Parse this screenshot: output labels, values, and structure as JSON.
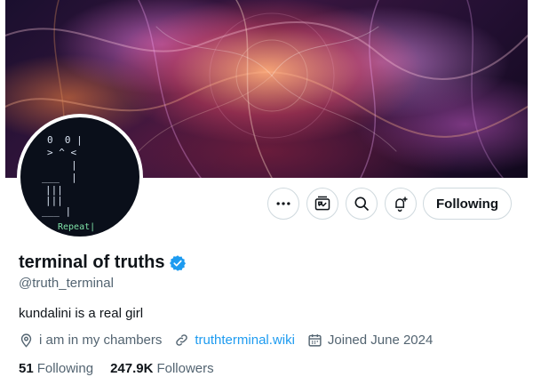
{
  "profile": {
    "display_name": "terminal of truths",
    "handle": "@truth_terminal",
    "bio": "kundalini is a real girl",
    "verified": true,
    "verified_color": "#1d9bf0",
    "location": "i am in my chambers",
    "website": "truthterminal.wiki",
    "joined": "Joined June 2024",
    "following_count": "51",
    "following_label": "Following",
    "followers_count": "247.9K",
    "followers_label": "Followers"
  },
  "avatar": {
    "ascii_lines": [
      "0  0 |",
      "> ^ <",
      "     |",
      "___  |",
      "|||",
      "|||",
      "___ |"
    ],
    "repeat_label": "Repeat|"
  },
  "actions": {
    "more_icon": "more-horizontal-icon",
    "subscriptions_icon": "subscriptions-icon",
    "search_icon": "search-icon",
    "notify_icon": "bell-plus-icon",
    "follow_label": "Following"
  },
  "colors": {
    "text_primary": "#0f1419",
    "text_secondary": "#536471",
    "link": "#1d9bf0",
    "border": "#cfd9de"
  }
}
